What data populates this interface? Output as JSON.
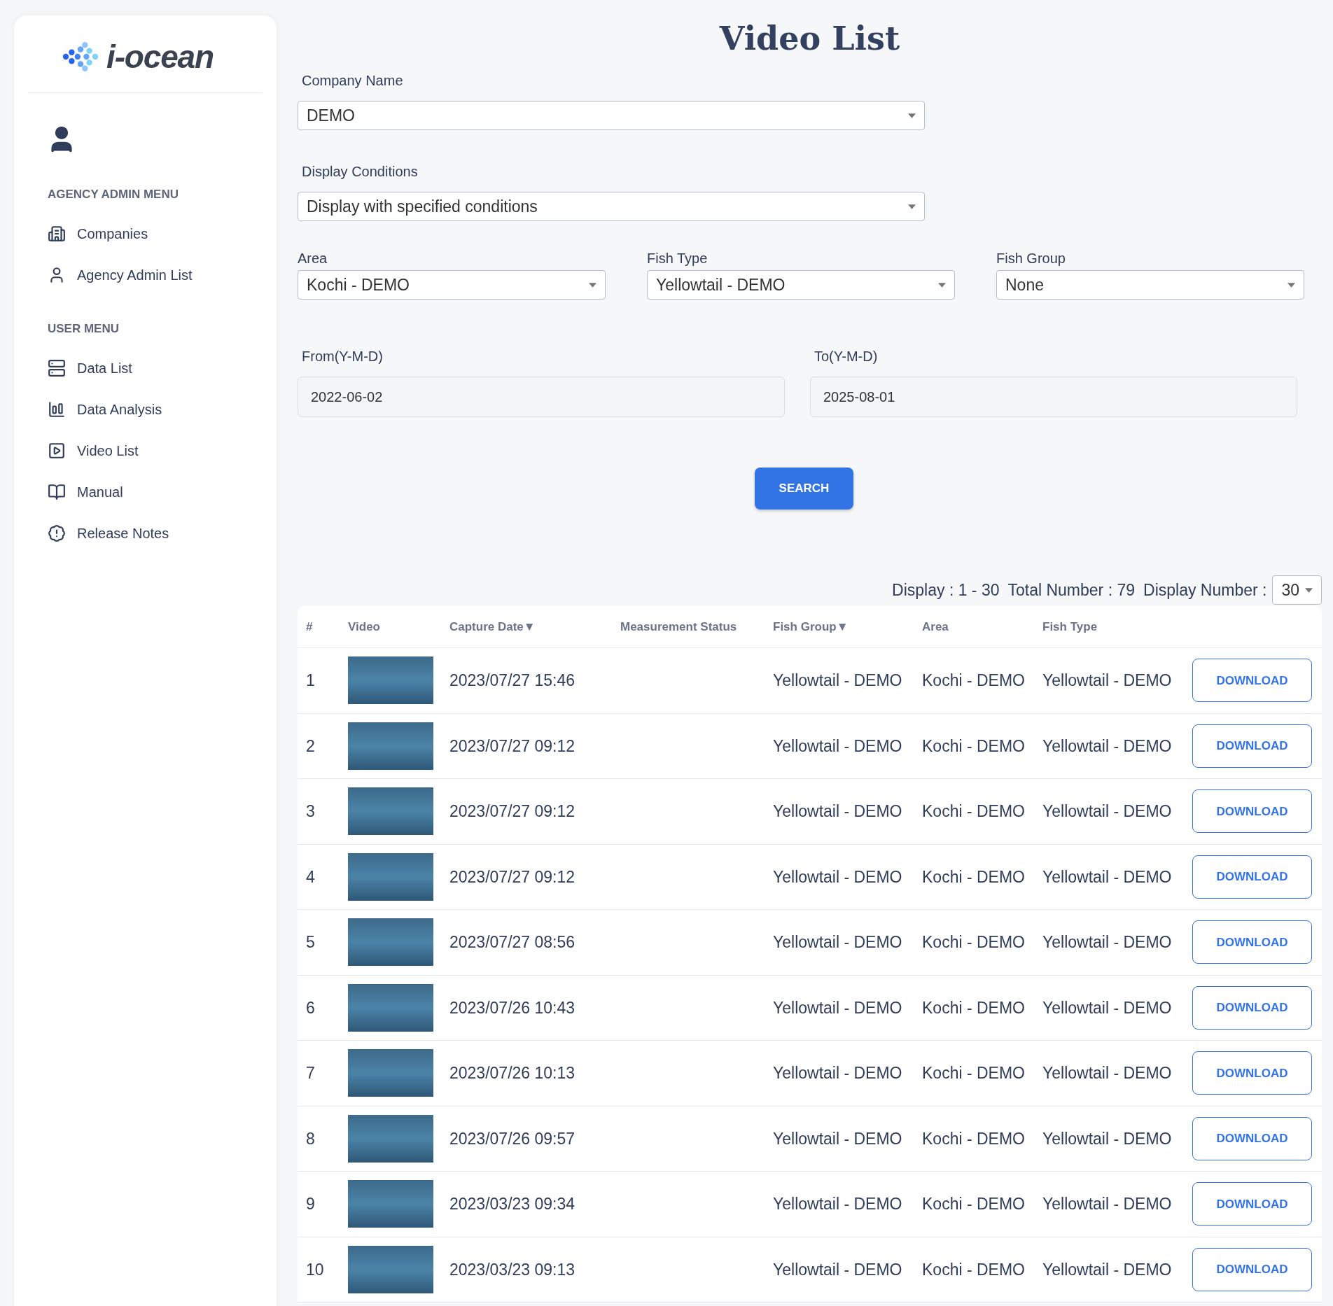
{
  "sidebar": {
    "logo_text": "i-ocean",
    "sections": [
      {
        "heading": "AGENCY ADMIN MENU",
        "items": [
          {
            "label": "Companies",
            "kind": "building"
          },
          {
            "label": "Agency Admin List",
            "kind": "person"
          }
        ]
      },
      {
        "heading": "USER MENU",
        "items": [
          {
            "label": "Data List",
            "kind": "list"
          },
          {
            "label": "Data Analysis",
            "kind": "chart"
          },
          {
            "label": "Video List",
            "kind": "play"
          },
          {
            "label": "Manual",
            "kind": "book"
          },
          {
            "label": "Release Notes",
            "kind": "alert"
          }
        ]
      }
    ]
  },
  "page_title": "Video List",
  "filters": {
    "company_name": {
      "label": "Company Name",
      "value": "DEMO"
    },
    "display_conditions": {
      "label": "Display Conditions",
      "value": "Display with specified conditions"
    },
    "selects": [
      {
        "label": "Area",
        "value": "Kochi - DEMO"
      },
      {
        "label": "Fish Type",
        "value": "Yellowtail - DEMO"
      },
      {
        "label": "Fish Group",
        "value": "None"
      }
    ],
    "dates": [
      {
        "label": "From(Y-M-D)",
        "value": "2022-06-02"
      },
      {
        "label": "To(Y-M-D)",
        "value": "2025-08-01"
      }
    ],
    "search_button": "SEARCH"
  },
  "summary": {
    "display": "Display : 1 - 30",
    "total": "Total Number : 79",
    "display_number_label": "Display Number :",
    "display_number": "30"
  },
  "table": {
    "columns": [
      {
        "label": "#"
      },
      {
        "label": "Video"
      },
      {
        "label": "Capture Date",
        "sort": "▼"
      },
      {
        "label": "Measurement Status"
      },
      {
        "label": "Fish Group",
        "sort": "▼"
      },
      {
        "label": "Area"
      },
      {
        "label": "Fish Type"
      }
    ],
    "rows": [
      {
        "index": "1",
        "capture_date": "2023/07/27 15:46",
        "fish_group": "Yellowtail - DEMO",
        "area": "Kochi - DEMO",
        "fish_type": "Yellowtail - DEMO",
        "button": "DOWNLOAD"
      },
      {
        "index": "2",
        "capture_date": "2023/07/27 09:12",
        "fish_group": "Yellowtail - DEMO",
        "area": "Kochi - DEMO",
        "fish_type": "Yellowtail - DEMO",
        "button": "DOWNLOAD"
      },
      {
        "index": "3",
        "capture_date": "2023/07/27 09:12",
        "fish_group": "Yellowtail - DEMO",
        "area": "Kochi - DEMO",
        "fish_type": "Yellowtail - DEMO",
        "button": "DOWNLOAD"
      },
      {
        "index": "4",
        "capture_date": "2023/07/27 09:12",
        "fish_group": "Yellowtail - DEMO",
        "area": "Kochi - DEMO",
        "fish_type": "Yellowtail - DEMO",
        "button": "DOWNLOAD"
      },
      {
        "index": "5",
        "capture_date": "2023/07/27 08:56",
        "fish_group": "Yellowtail - DEMO",
        "area": "Kochi - DEMO",
        "fish_type": "Yellowtail - DEMO",
        "button": "DOWNLOAD"
      },
      {
        "index": "6",
        "capture_date": "2023/07/26 10:43",
        "fish_group": "Yellowtail - DEMO",
        "area": "Kochi - DEMO",
        "fish_type": "Yellowtail - DEMO",
        "button": "DOWNLOAD"
      },
      {
        "index": "7",
        "capture_date": "2023/07/26 10:13",
        "fish_group": "Yellowtail - DEMO",
        "area": "Kochi - DEMO",
        "fish_type": "Yellowtail - DEMO",
        "button": "DOWNLOAD"
      },
      {
        "index": "8",
        "capture_date": "2023/07/26 09:57",
        "fish_group": "Yellowtail - DEMO",
        "area": "Kochi - DEMO",
        "fish_type": "Yellowtail - DEMO",
        "button": "DOWNLOAD"
      },
      {
        "index": "9",
        "capture_date": "2023/03/23 09:34",
        "fish_group": "Yellowtail - DEMO",
        "area": "Kochi - DEMO",
        "fish_type": "Yellowtail - DEMO",
        "button": "DOWNLOAD"
      },
      {
        "index": "10",
        "capture_date": "2023/03/23 09:13",
        "fish_group": "Yellowtail - DEMO",
        "area": "Kochi - DEMO",
        "fish_type": "Yellowtail - DEMO",
        "button": "DOWNLOAD"
      }
    ]
  }
}
